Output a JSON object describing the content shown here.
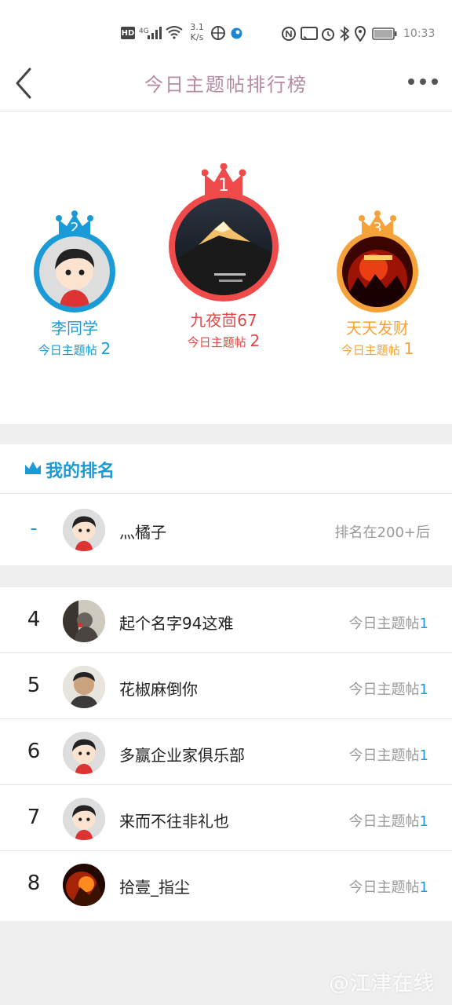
{
  "status_bar": {
    "hd": "HD",
    "network": "4G",
    "speed_value": "3.1",
    "speed_unit": "K/s",
    "time": "10:33",
    "icons": [
      "signal-icon",
      "wifi-icon",
      "globe-icon",
      "app-dot-icon",
      "nfc-icon",
      "cast-icon",
      "alarm-icon",
      "bluetooth-icon",
      "location-icon",
      "battery-icon"
    ]
  },
  "nav": {
    "title": "今日主题帖排行榜",
    "back_icon": "chevron-left-icon",
    "more_icon": "more-dots-icon"
  },
  "podium": {
    "colors": {
      "gold": "#f04b4b",
      "silver": "#1a9ad6",
      "bronze": "#f5a23b"
    },
    "label": "今日主题帖",
    "first": {
      "rank": "1",
      "name": "九夜茴67",
      "count": "2"
    },
    "second": {
      "rank": "2",
      "name": "李同学",
      "count": "2"
    },
    "third": {
      "rank": "3",
      "name": "天天发财",
      "count": "1"
    }
  },
  "my_rank": {
    "title": "我的排名",
    "rank": "-",
    "name": "灬橘子",
    "status": "排名在200+后"
  },
  "list": {
    "label": "今日主题帖",
    "rows": [
      {
        "rank": "4",
        "name": "起个名字94这难",
        "count": "1"
      },
      {
        "rank": "5",
        "name": "花椒麻倒你",
        "count": "1"
      },
      {
        "rank": "6",
        "name": "多赢企业家俱乐部",
        "count": "1"
      },
      {
        "rank": "7",
        "name": "来而不往非礼也",
        "count": "1"
      },
      {
        "rank": "8",
        "name": "拾壹_指尘",
        "count": "1"
      }
    ]
  },
  "watermark": "@江津在线"
}
